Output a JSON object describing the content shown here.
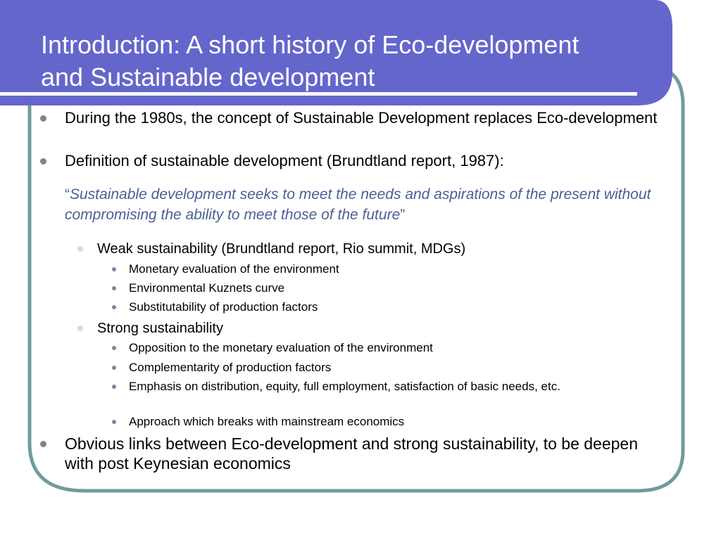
{
  "title": {
    "line1": "Introduction: A short history of Eco-development",
    "line2": "and Sustainable development"
  },
  "bullets": [
    {
      "text": "During the 1980s, the concept of Sustainable  Development replaces Eco-development"
    },
    {
      "text": "Definition of sustainable development (Brundtland report, 1987):"
    }
  ],
  "quote": {
    "open": "“",
    "text": "Sustainable development seeks to meet the needs and aspirations of the present without compromising the ability to meet those of the future",
    "close": "”"
  },
  "weak": {
    "label": "Weak sustainability (Brundtland report, Rio summit, MDGs)",
    "items": [
      "Monetary evaluation of the environment",
      "Environmental Kuznets curve",
      "Substitutability of production factors"
    ]
  },
  "strong": {
    "label": "Strong sustainability",
    "items": [
      "Opposition to the monetary evaluation of the environment",
      "Complementarity of production factors",
      "Emphasis on distribution, equity, full employment, satisfaction of basic needs, etc.",
      "Approach which breaks with mainstream economics"
    ]
  },
  "conclusion": {
    "text": "Obvious links between Eco-development and strong sustainability, to be deepen with post Keynesian economics"
  },
  "colors": {
    "title_bg": "#6466cc",
    "border": "#6f9c9c",
    "quote_text": "#4a5f95",
    "bullet_l1": "#8f7f73",
    "bullet_l2": "#c9ddf5",
    "bullet_l3": "#7788a5"
  }
}
